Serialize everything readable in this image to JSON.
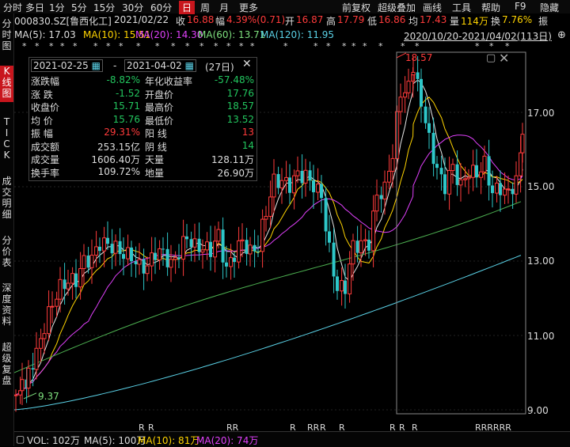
{
  "menu": {
    "items": [
      "分时",
      "多日",
      "1分",
      "5分",
      "15分",
      "30分",
      "60分",
      "日",
      "周",
      "月",
      "更多"
    ],
    "active_index": 7,
    "right_items": [
      "前复权",
      "超级叠加",
      "画线",
      "工具",
      "帮助",
      "F9",
      "隐藏"
    ]
  },
  "sidebar": {
    "tabs": [
      {
        "label": "分\n时\n图",
        "active": false
      },
      {
        "label": "K\n线\n图",
        "active": true
      },
      {
        "label": "T\nI\nC\nK",
        "active": false
      },
      {
        "label": "成\n交\n明\n细",
        "active": false
      },
      {
        "label": "分\n价\n表",
        "active": false
      },
      {
        "label": "深\n度\n资\n料",
        "active": false
      },
      {
        "label": "超\n级\n复\n盘",
        "active": false
      }
    ]
  },
  "info": {
    "code": "000830.SZ[鲁西化工]",
    "date": "2021/02/22",
    "close_label": "收",
    "close": "16.88",
    "change_label": "幅",
    "change": "4.39%(0.71)",
    "open_label": "开",
    "open": "16.87",
    "high_label": "高",
    "high": "17.79",
    "low_label": "低",
    "low": "16.86",
    "avg_label": "均",
    "avg": "17.43",
    "vol_label": "量",
    "vol": "114万",
    "turnover_label": "换",
    "turnover": "7.76%",
    "amp_label": "振"
  },
  "ma_legend": {
    "ma5": "MA(5): 17.03",
    "ma10": "MA(10): 15.51",
    "ma20": "MA(20): 14.30",
    "ma60": "MA(60): 13.71",
    "ma120": "MA(120): 11.95",
    "range": "2020/10/20-2021/04/02(113日)"
  },
  "stats": {
    "start_date": "2021-02-25",
    "sep": "-",
    "end_date": "2021-04-02",
    "days": "(27日)",
    "rows": [
      {
        "l1": "涨跌幅",
        "v1": "-8.82%",
        "c1": "green",
        "l2": "年化收益率",
        "v2": "-57.48%",
        "c2": "green"
      },
      {
        "l1": "涨  跌",
        "v1": "-1.52",
        "c1": "green",
        "l2": "开盘价",
        "v2": "17.76",
        "c2": "green"
      },
      {
        "l1": "收盘价",
        "v1": "15.71",
        "c1": "green",
        "l2": "最高价",
        "v2": "18.57",
        "c2": "green"
      },
      {
        "l1": "均  价",
        "v1": "15.76",
        "c1": "green",
        "l2": "最低价",
        "v2": "13.52",
        "c2": "green"
      },
      {
        "l1": "振  幅",
        "v1": "29.31%",
        "c1": "red",
        "l2": "阳  线",
        "v2": "13",
        "c2": "red"
      },
      {
        "l1": "成交额",
        "v1": "253.15亿",
        "c1": "white",
        "l2": "阴  线",
        "v2": "14",
        "c2": "green"
      },
      {
        "l1": "成交量",
        "v1": "1606.40万",
        "c1": "white",
        "l2": "天量",
        "v2": "128.11万",
        "c2": "white"
      },
      {
        "l1": "换手率",
        "v1": "109.72%",
        "c1": "white",
        "l2": "地量",
        "v2": "26.90万",
        "c2": "white"
      }
    ]
  },
  "price_axis": [
    "17.00",
    "15.00",
    "13.00",
    "11.00",
    "9.00"
  ],
  "annotations": {
    "high": "18.57",
    "low": "9.37"
  },
  "vol_legend": {
    "vol": "VOL: 102万",
    "ma5": "MA(5): 100万",
    "ma10": "MA(10): 81万",
    "ma20": "MA(20): 74万"
  },
  "colors": {
    "up": "#ff3b3b",
    "down": "#2ec7c9",
    "ma5": "#e8e8e8",
    "ma10": "#ffd400",
    "ma20": "#e040fb",
    "ma60": "#4caf50",
    "ma120": "#5ad1e6",
    "active": "#c8161d"
  }
}
